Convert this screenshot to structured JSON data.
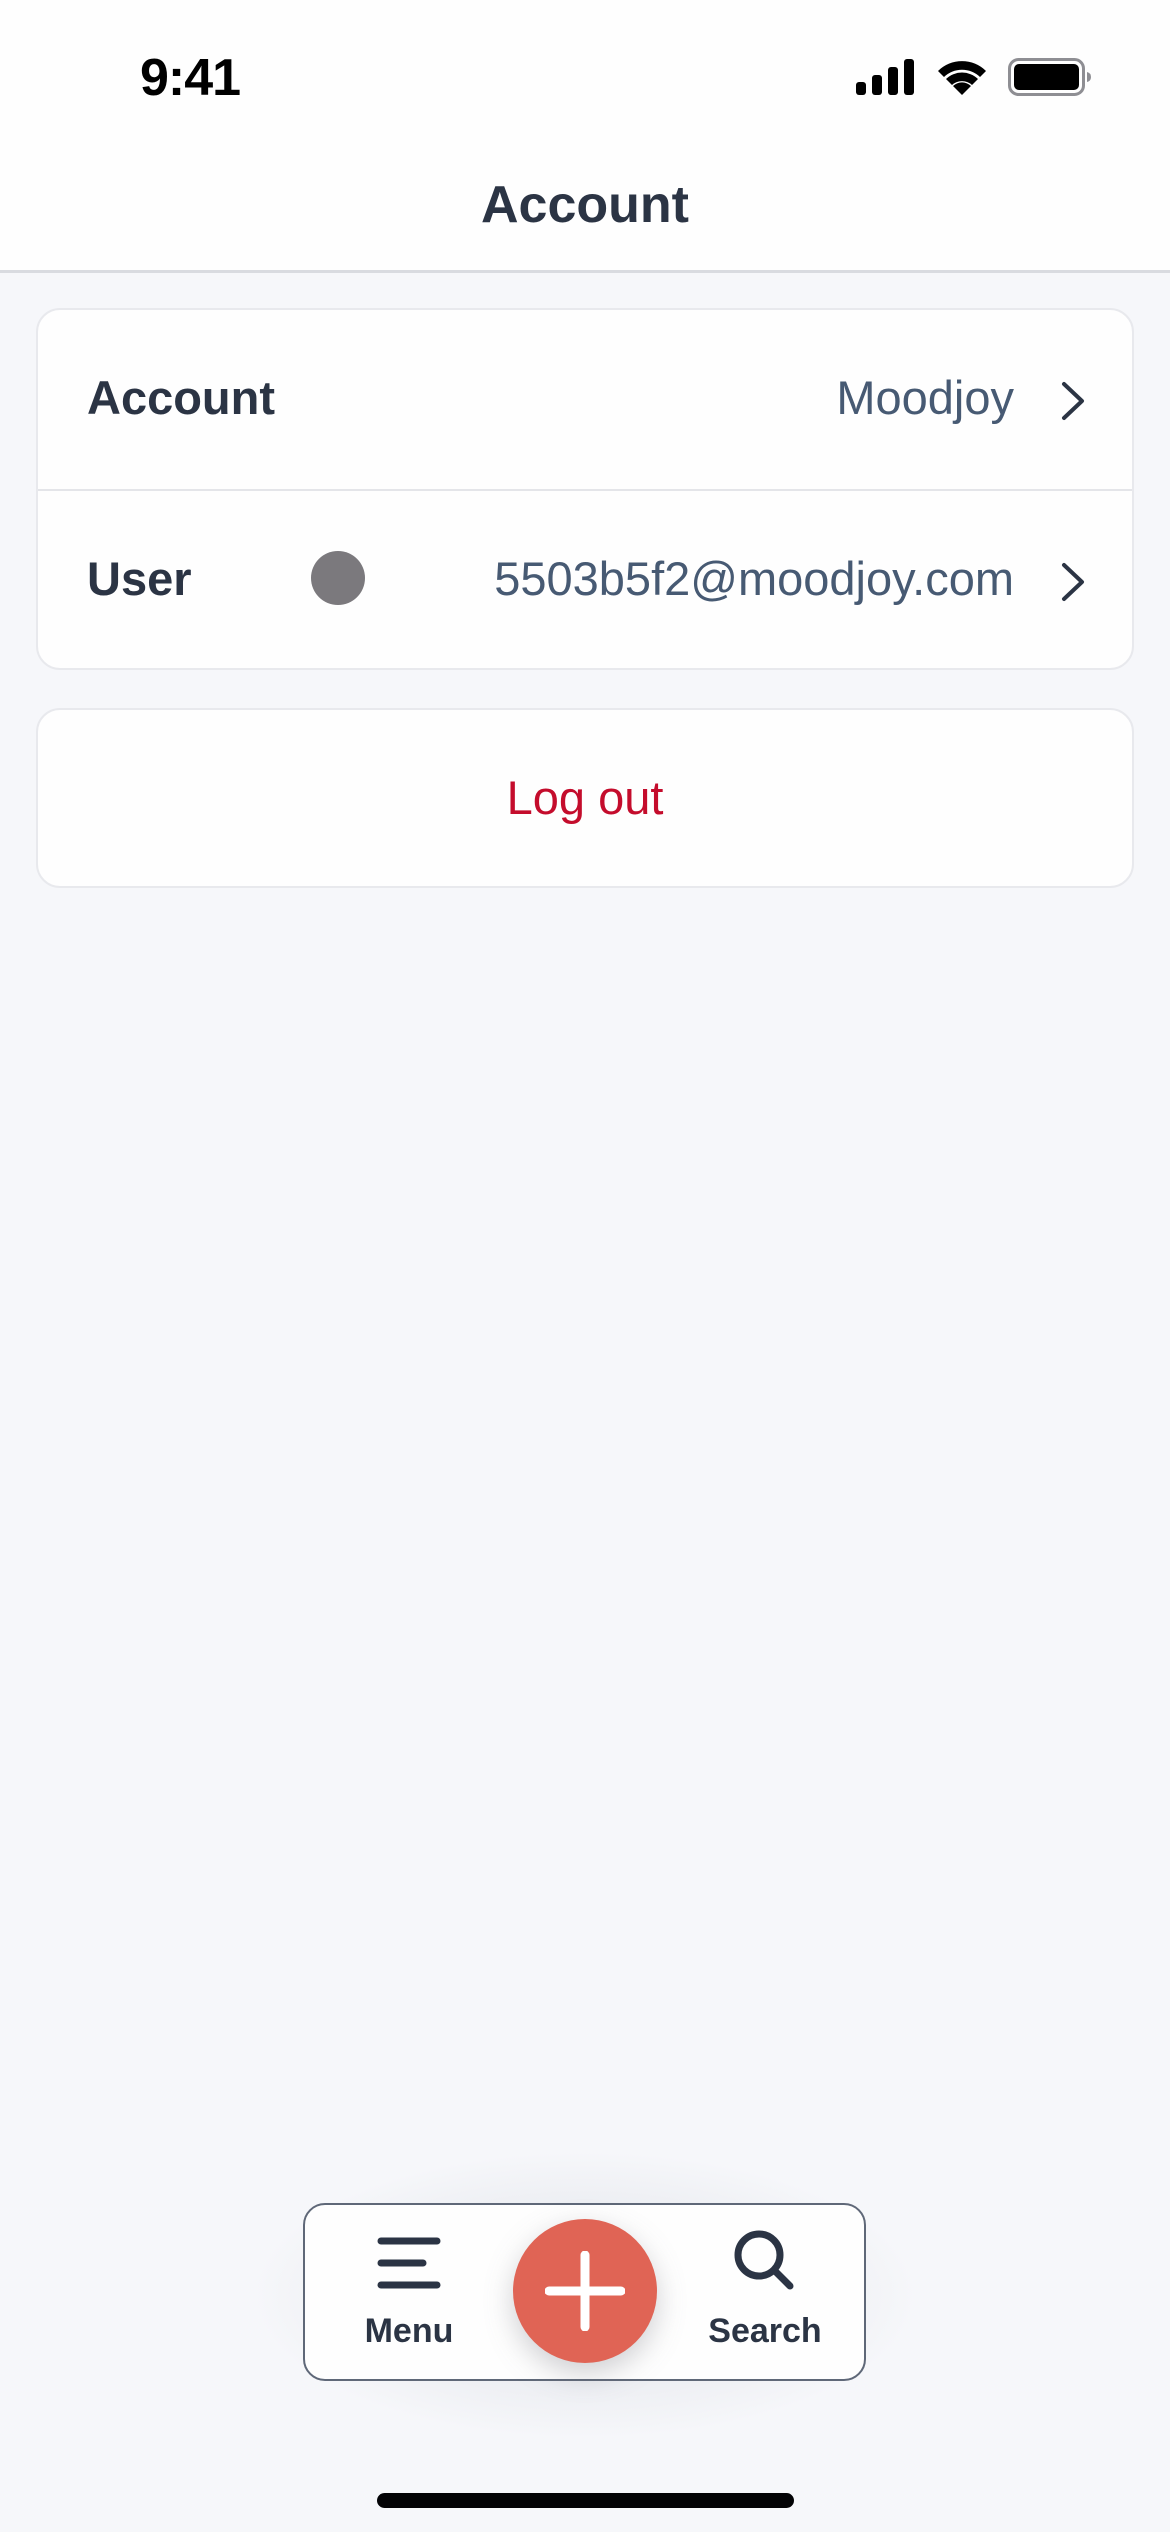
{
  "status_bar": {
    "time": "9:41",
    "icons": [
      "cellular-signal-icon",
      "wifi-icon",
      "battery-icon"
    ]
  },
  "header": {
    "title": "Account"
  },
  "account_card": {
    "rows": [
      {
        "label": "Account",
        "value": "Moodjoy",
        "icon": "chevron-right-icon"
      },
      {
        "label": "User",
        "value": "5503b5f2@moodjoy.com",
        "avatar": "avatar-dot",
        "icon": "chevron-right-icon"
      }
    ]
  },
  "logout": {
    "label": "Log out"
  },
  "tab_bar": {
    "items": [
      {
        "label": "Menu",
        "icon": "menu-icon"
      },
      {
        "label": "",
        "icon": "plus-icon"
      },
      {
        "label": "Search",
        "icon": "search-icon"
      }
    ]
  },
  "colors": {
    "background": "#f6f7fa",
    "surface": "#fefefe",
    "text_primary": "#2b3444",
    "text_secondary": "#475a73",
    "danger": "#c40c2c",
    "accent": "#e06455",
    "avatar_placeholder": "#7b797d"
  }
}
